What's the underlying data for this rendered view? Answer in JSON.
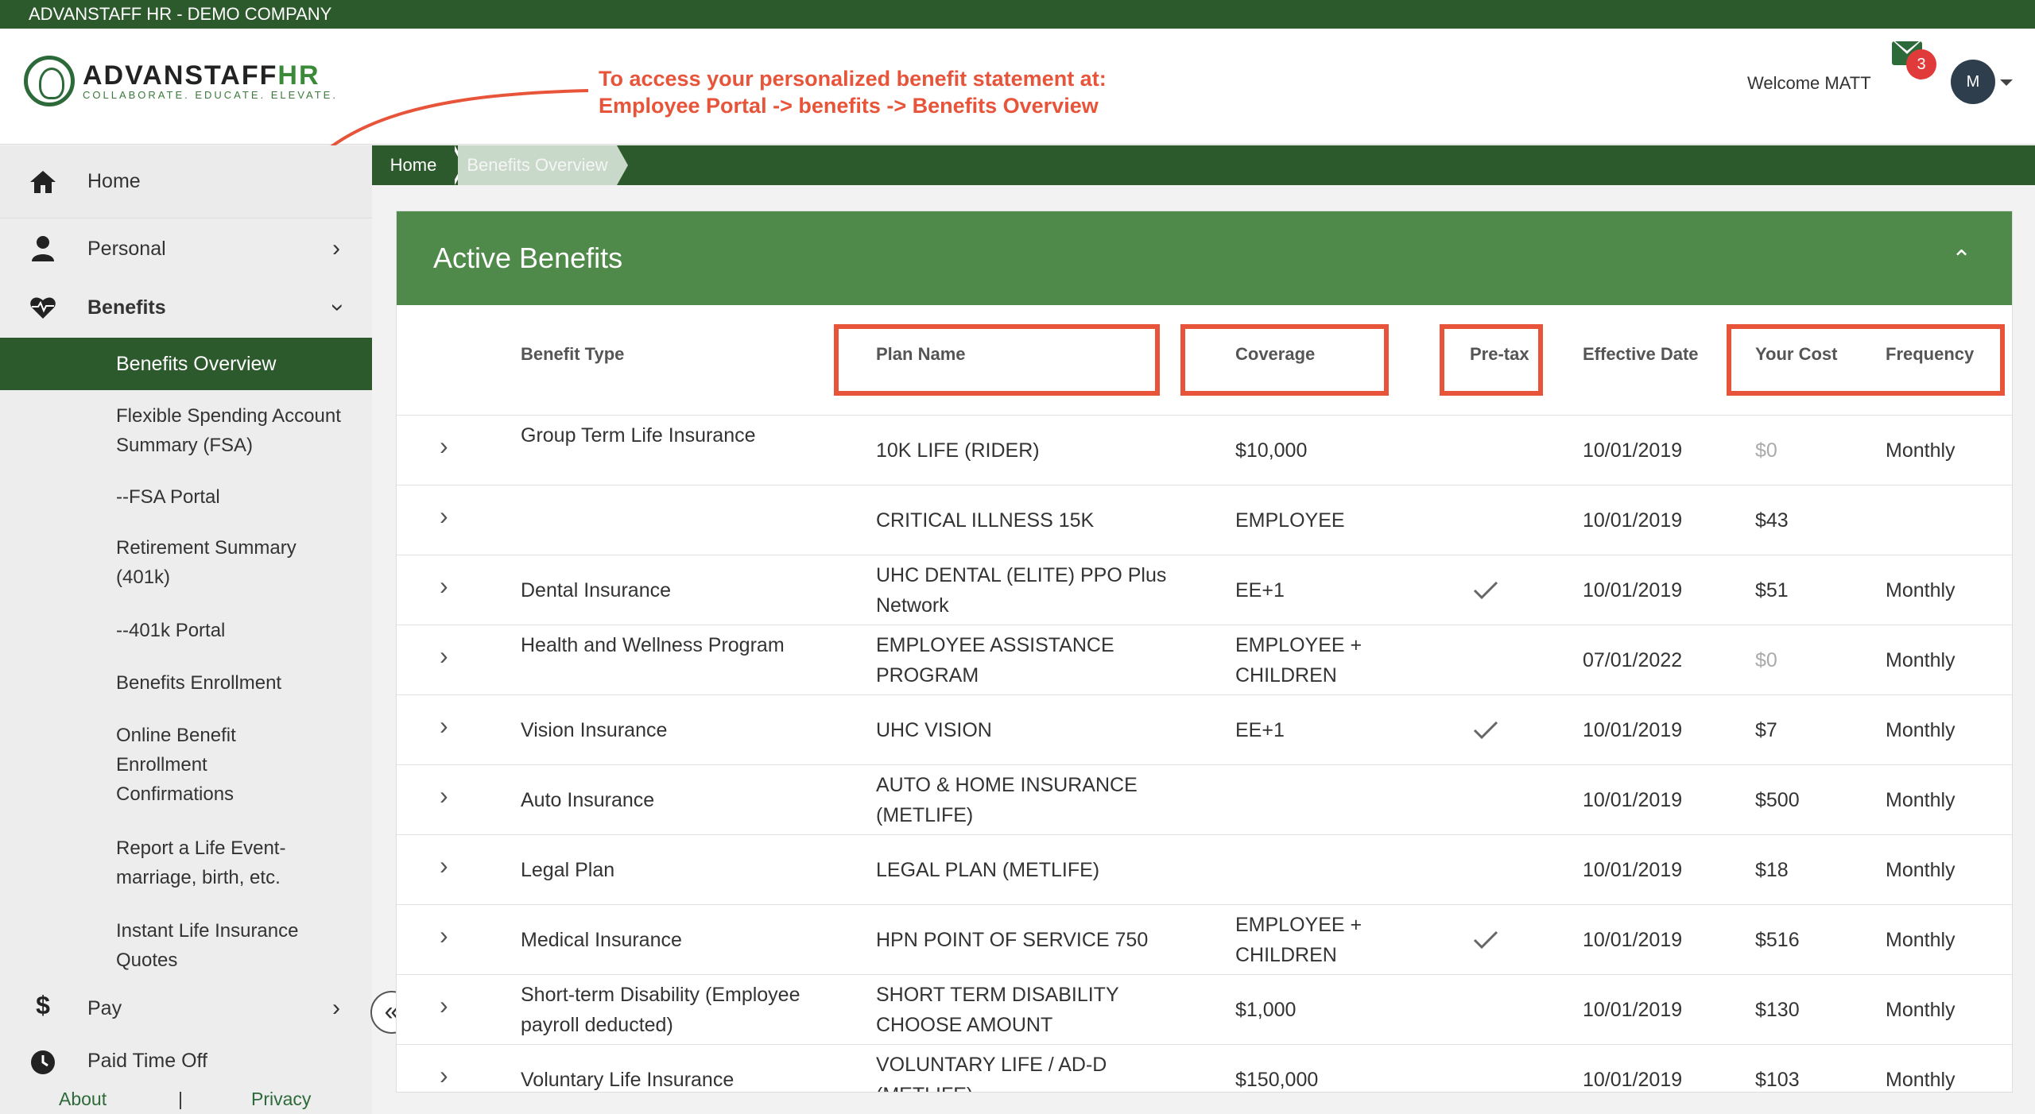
{
  "app": {
    "company_bar": "ADVANSTAFF HR - DEMO COMPANY"
  },
  "header": {
    "logo_main_a": "ADVANSTAFF",
    "logo_main_b": "HR",
    "logo_tagline": "COLLABORATE. EDUCATE. ELEVATE.",
    "annotation_line1": "To access your personalized benefit statement at:",
    "annotation_line2": "Employee Portal -> benefits -> Benefits Overview",
    "welcome": "Welcome MATT",
    "mail_count": "3",
    "avatar_initial": "M"
  },
  "sidebar": {
    "home": "Home",
    "personal": "Personal",
    "benefits": "Benefits",
    "sub_items": [
      "Benefits Overview",
      "Flexible Spending Account Summary (FSA)",
      "--FSA Portal",
      "Retirement Summary (401k)",
      "--401k Portal",
      "Benefits Enrollment",
      "Online Benefit Enrollment Confirmations",
      "Report a Life Event- marriage, birth, etc.",
      "Instant Life Insurance Quotes"
    ],
    "pay": "Pay",
    "pto": "Paid Time Off",
    "footer_about": "About",
    "footer_sep": "|",
    "footer_privacy": "Privacy"
  },
  "breadcrumb": {
    "home": "Home",
    "current": "Benefits Overview"
  },
  "panel": {
    "title": "Active Benefits",
    "columns": [
      "Benefit Type",
      "Plan Name",
      "Coverage",
      "Pre-tax",
      "Effective Date",
      "Your Cost",
      "Frequency"
    ],
    "rows": [
      {
        "type": "Group Term Life Insurance",
        "plan": "10K LIFE (RIDER)",
        "coverage": "$10,000",
        "pretax": false,
        "date": "10/01/2019",
        "cost": "$0",
        "cost_muted": true,
        "freq": "Monthly"
      },
      {
        "type": "",
        "plan": "CRITICAL ILLNESS 15K",
        "coverage": "EMPLOYEE",
        "pretax": false,
        "date": "10/01/2019",
        "cost": "$43",
        "cost_muted": false,
        "freq": ""
      },
      {
        "type": "Dental Insurance",
        "plan": "UHC DENTAL (ELITE) PPO Plus Network",
        "coverage": "EE+1",
        "pretax": true,
        "date": "10/01/2019",
        "cost": "$51",
        "cost_muted": false,
        "freq": "Monthly"
      },
      {
        "type": "Health and Wellness Program",
        "plan": "EMPLOYEE ASSISTANCE PROGRAM",
        "coverage": "EMPLOYEE + CHILDREN",
        "pretax": false,
        "date": "07/01/2022",
        "cost": "$0",
        "cost_muted": true,
        "freq": "Monthly"
      },
      {
        "type": "Vision Insurance",
        "plan": "UHC VISION",
        "coverage": "EE+1",
        "pretax": true,
        "date": "10/01/2019",
        "cost": "$7",
        "cost_muted": false,
        "freq": "Monthly"
      },
      {
        "type": "Auto Insurance",
        "plan": "AUTO & HOME INSURANCE (METLIFE)",
        "coverage": "",
        "pretax": false,
        "date": "10/01/2019",
        "cost": "$500",
        "cost_muted": false,
        "freq": "Monthly"
      },
      {
        "type": "Legal Plan",
        "plan": "LEGAL PLAN (METLIFE)",
        "coverage": "",
        "pretax": false,
        "date": "10/01/2019",
        "cost": "$18",
        "cost_muted": false,
        "freq": "Monthly"
      },
      {
        "type": "Medical Insurance",
        "plan": "HPN POINT OF SERVICE 750",
        "coverage": "EMPLOYEE + CHILDREN",
        "pretax": true,
        "date": "10/01/2019",
        "cost": "$516",
        "cost_muted": false,
        "freq": "Monthly"
      },
      {
        "type": "Short-term Disability (Employee payroll deducted)",
        "plan": "SHORT TERM DISABILITY CHOOSE AMOUNT",
        "coverage": "$1,000",
        "pretax": false,
        "date": "10/01/2019",
        "cost": "$130",
        "cost_muted": false,
        "freq": "Monthly"
      },
      {
        "type": "Voluntary Life Insurance",
        "plan": "VOLUNTARY LIFE / AD-D (METLIFE)",
        "coverage": "$150,000",
        "pretax": false,
        "date": "10/01/2019",
        "cost": "$103",
        "cost_muted": false,
        "freq": "Monthly"
      }
    ]
  },
  "colors": {
    "brand_dark": "#2d5a2d",
    "panel_green": "#4f8a4a",
    "annotation": "#e8543a"
  },
  "icons": {
    "home": "home-icon",
    "personal": "user-icon",
    "benefits": "heart-pulse-icon",
    "pay": "dollar-icon",
    "pto": "clock-icon",
    "mail": "envelope-icon",
    "collapse": "double-chevron-left-icon",
    "pretax": "checkmark-icon"
  }
}
